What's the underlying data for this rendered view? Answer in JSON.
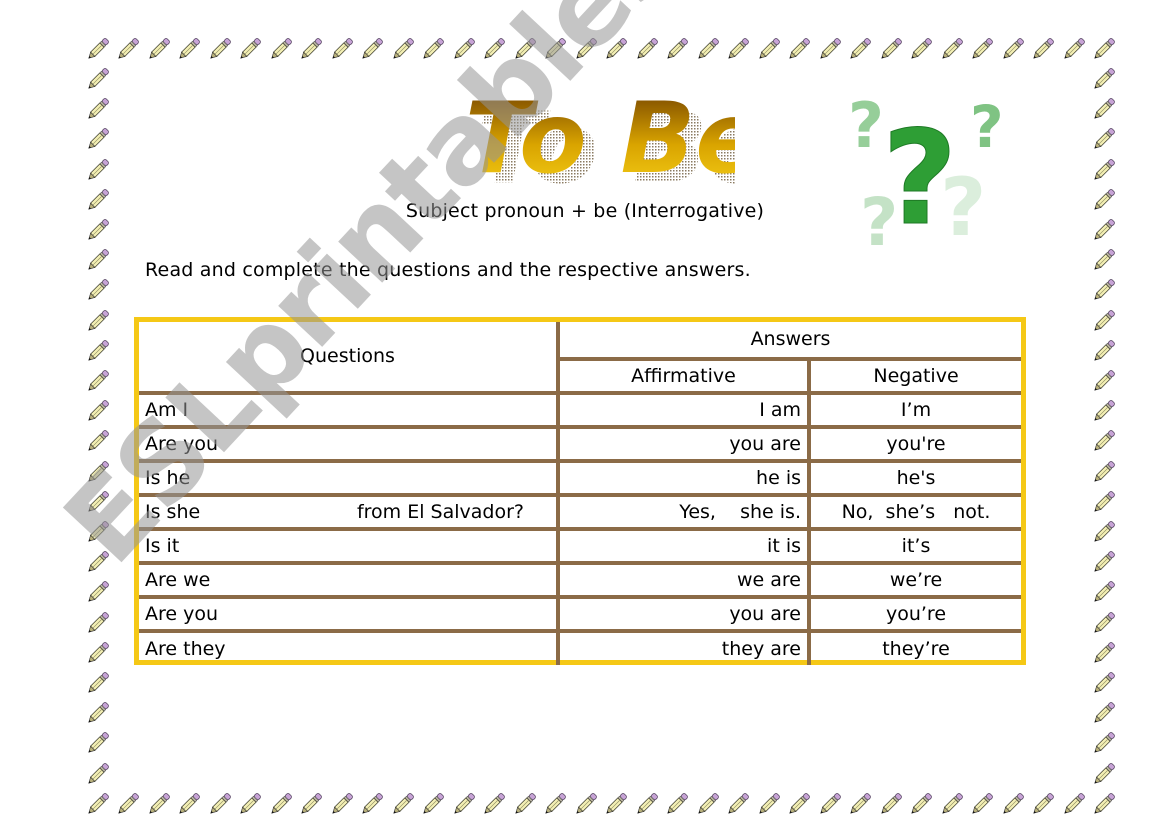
{
  "worksheet": {
    "title": "To Be",
    "subtitle": "Subject pronoun + be (Interrogative)",
    "instruction": "Read and complete the questions and the respective answers.",
    "watermark": "ESLprintables.com",
    "border_icon": "pencil-icon",
    "decoration_icon": "question-marks-icon"
  },
  "colors": {
    "table_outer_border": "#F5C816",
    "table_inner_lines": "#8B6B47",
    "title_gradient_top": "#6B3A00",
    "title_gradient_bottom": "#F2C200",
    "question_mark_green": "#2E9E35",
    "pencil_eraser": "#C7A3D6",
    "pencil_body": "#F3EFB4"
  },
  "table": {
    "headers": {
      "questions": "Questions",
      "answers": "Answers",
      "affirmative": "Affirmative",
      "negative": "Negative"
    },
    "rows": [
      {
        "question": "Am I",
        "question_suffix": "",
        "affirmative": "I am",
        "negative": "I’m"
      },
      {
        "question": "Are you",
        "question_suffix": "",
        "affirmative": "you are",
        "negative": "you're"
      },
      {
        "question": "Is he",
        "question_suffix": "",
        "affirmative": "he is",
        "negative": "he's"
      },
      {
        "question": "Is she",
        "question_suffix": "from El Salvador?",
        "affirmative": "Yes,    she is.",
        "negative": "No,  she’s   not."
      },
      {
        "question": "Is it",
        "question_suffix": "",
        "affirmative": "it is",
        "negative": "it’s"
      },
      {
        "question": "Are we",
        "question_suffix": "",
        "affirmative": "we are",
        "negative": "we’re"
      },
      {
        "question": "Are you",
        "question_suffix": "",
        "affirmative": "you are",
        "negative": "you’re"
      },
      {
        "question": "Are they",
        "question_suffix": "",
        "affirmative": "they are",
        "negative": "they’re"
      }
    ]
  }
}
